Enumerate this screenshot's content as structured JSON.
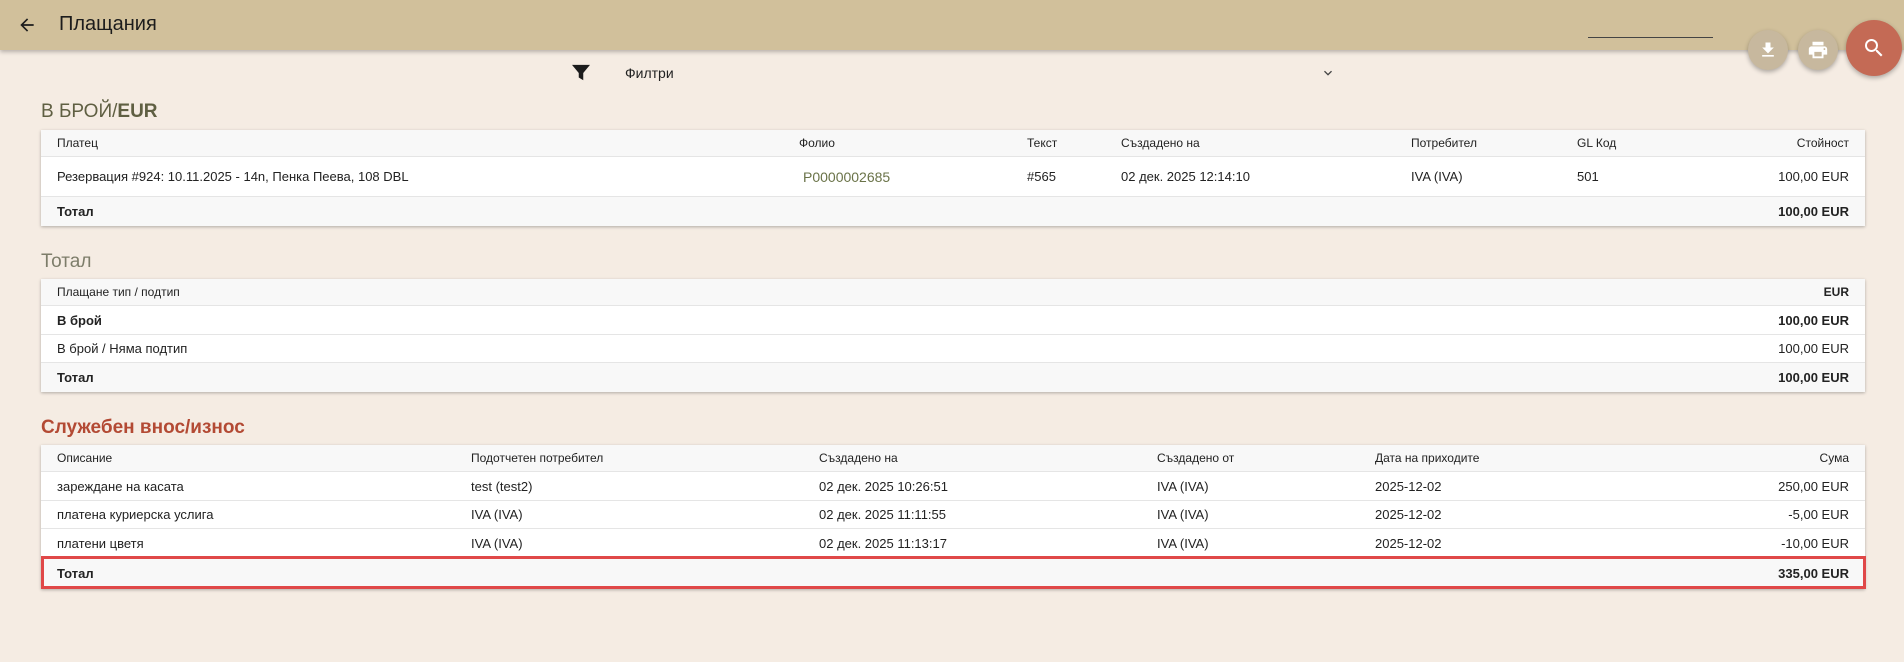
{
  "header": {
    "title": "Плащания",
    "back_icon": "arrow-left-icon",
    "actions": [
      "download-icon",
      "print-icon",
      "search-icon"
    ]
  },
  "filters": {
    "label": "Филтри"
  },
  "cash_section": {
    "title_prefix": "В БРОЙ/",
    "currency": "EUR",
    "columns": [
      "Платец",
      "Фолио",
      "Текст",
      "Създадено на",
      "Потребител",
      "GL Код",
      "Стойност"
    ],
    "rows": [
      {
        "payer": "Резервация #924: 10.11.2025 - 14n, Пенка Пеева, 108 DBL",
        "folio": "P0000002685",
        "text": "#565",
        "created": "02 дек. 2025 12:14:10",
        "user": "IVA (IVA)",
        "gl_code": "501",
        "value": "100,00 EUR"
      }
    ],
    "total_label": "Тотал",
    "total_value": "100,00 EUR"
  },
  "total_section": {
    "title": "Тотал",
    "col_type": "Плащане тип / подтип",
    "col_currency": "EUR",
    "rows": [
      {
        "label": "В брой",
        "value": "100,00 EUR",
        "bold": true
      },
      {
        "label": "В брой / Няма подтип",
        "value": "100,00 EUR",
        "bold": false
      }
    ],
    "total_label": "Тотал",
    "total_value": "100,00 EUR"
  },
  "service_section": {
    "title": "Служебен внос/износ",
    "columns": [
      "Описание",
      "Подотчетен потребител",
      "Създадено на",
      "Създадено от",
      "Дата на приходите",
      "Сума"
    ],
    "rows": [
      {
        "desc": "зареждане на касата",
        "accountable": "test (test2)",
        "created": "02 дек. 2025 10:26:51",
        "created_by": "IVA (IVA)",
        "revenue_date": "2025-12-02",
        "amount": "250,00 EUR"
      },
      {
        "desc": "платена куриерска услига",
        "accountable": "IVA (IVA)",
        "created": "02 дек. 2025 11:11:55",
        "created_by": "IVA (IVA)",
        "revenue_date": "2025-12-02",
        "amount": "-5,00 EUR"
      },
      {
        "desc": "платени цветя",
        "accountable": "IVA (IVA)",
        "created": "02 дек. 2025 11:13:17",
        "created_by": "IVA (IVA)",
        "revenue_date": "2025-12-02",
        "amount": "-10,00 EUR"
      }
    ],
    "total_label": "Тотал",
    "total_value": "335,00 EUR"
  },
  "colors": {
    "header_bg": "#d1c09b",
    "page_bg": "#f5ece3",
    "accent_red": "#b34a34",
    "search_button": "#c46a55",
    "highlight_border": "#e04848"
  }
}
